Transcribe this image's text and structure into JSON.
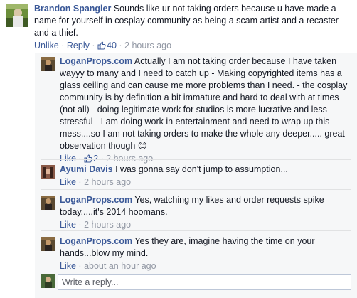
{
  "comments": [
    {
      "author": "Brandon Spangler",
      "text": "Sounds like ur not taking orders because u have made a name for yourself in cosplay community as being a scam artist and a recaster and a thief.",
      "actions": {
        "unlike": "Unlike",
        "reply": "Reply",
        "likes": "40",
        "time": "2 hours ago"
      }
    },
    {
      "author": "LoganProps.com",
      "text": "Actually I am not taking order because I have taken wayyy to many and I need to catch up - Making copyrighted items has a glass ceiling and can cause me more problems than I need. - the cosplay community is by definition a bit immature and hard to deal with at times (not all) - doing legitimate work for studios is more lucrative and less stressful - I am doing work in entertainment and need to wrap up this mess....so I am not taking orders to make the whole any deeper..... great observation though 😊",
      "actions": {
        "like": "Like",
        "likes": "2",
        "time": "2 hours ago"
      }
    },
    {
      "author": "Ayumi Davis",
      "text": "I was gonna say don't jump to assumption...",
      "actions": {
        "like": "Like",
        "time": "2 hours ago"
      }
    },
    {
      "author": "LoganProps.com",
      "text": "Yes, watching my likes and order requests spike today.....it's 2014 hoomans.",
      "actions": {
        "like": "Like",
        "time": "2 hours ago"
      }
    },
    {
      "author": "LoganProps.com",
      "text": "Yes they are, imagine having the time on your hands...blow my mind.",
      "actions": {
        "like": "Like",
        "time": "about an hour ago"
      }
    }
  ],
  "reply": {
    "placeholder": "Write a reply..."
  },
  "icons": {
    "like": "thumbs-up-icon",
    "smiley": "smiley-icon"
  },
  "colors": {
    "link": "#3b5998",
    "meta": "#9197a3",
    "reply_bg": "#f6f7f8"
  }
}
